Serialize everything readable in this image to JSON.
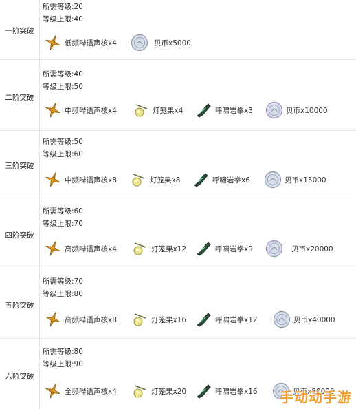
{
  "labels": {
    "req_level": "所需等级:",
    "max_level": "等级上限:"
  },
  "rows": [
    {
      "stage": "一阶突破",
      "req": "20",
      "max": "40",
      "items": [
        {
          "icon": "shard-icon",
          "text": "低频哔语声核x4"
        },
        {
          "icon": "coin-icon",
          "text": "贝币x5000"
        }
      ]
    },
    {
      "stage": "二阶突破",
      "req": "40",
      "max": "50",
      "items": [
        {
          "icon": "shard-icon",
          "text": "中频哔语声核x4"
        },
        {
          "icon": "lantern-fruit-icon",
          "text": "灯笼果x4"
        },
        {
          "icon": "gauntlet-icon",
          "text": "呼啸岩拳x3"
        },
        {
          "icon": "coin-icon",
          "text": "贝币x10000"
        }
      ]
    },
    {
      "stage": "三阶突破",
      "req": "50",
      "max": "60",
      "items": [
        {
          "icon": "shard-icon",
          "text": "中频哔语声核x8"
        },
        {
          "icon": "lantern-fruit-icon",
          "text": "灯笼果x8"
        },
        {
          "icon": "gauntlet-icon",
          "text": "呼啸岩拳x6"
        },
        {
          "icon": "coin-icon",
          "text": "贝币x15000"
        }
      ]
    },
    {
      "stage": "四阶突破",
      "req": "60",
      "max": "70",
      "items": [
        {
          "icon": "shard-icon",
          "text": "高频哔语声核x4"
        },
        {
          "icon": "lantern-fruit-icon",
          "text": "灯笼果x12"
        },
        {
          "icon": "gauntlet-icon",
          "text": "呼啸岩拳x9"
        },
        {
          "icon": "coin-icon",
          "text": "贝币x20000"
        }
      ]
    },
    {
      "stage": "五阶突破",
      "req": "70",
      "max": "80",
      "items": [
        {
          "icon": "shard-icon",
          "text": "高频哔语声核x8"
        },
        {
          "icon": "lantern-fruit-icon",
          "text": "灯笼果x16"
        },
        {
          "icon": "gauntlet-icon",
          "text": "呼啸岩拳x12"
        },
        {
          "icon": "coin-icon",
          "text": "贝币x40000"
        }
      ]
    },
    {
      "stage": "六阶突破",
      "req": "80",
      "max": "90",
      "items": [
        {
          "icon": "shard-icon",
          "text": "全频哔语声核x4"
        },
        {
          "icon": "lantern-fruit-icon",
          "text": "灯笼果x20"
        },
        {
          "icon": "gauntlet-icon",
          "text": "呼啸岩拳x16"
        },
        {
          "icon": "coin-icon",
          "text": "贝币x80000"
        }
      ]
    }
  ],
  "watermark": "手动动手游",
  "colors": {
    "shard": "#d9951a",
    "lantern": "#b8b66a",
    "gauntlet": "#2e4a3a",
    "coin": "#a9b2c8",
    "watermark": "#f39a28"
  }
}
